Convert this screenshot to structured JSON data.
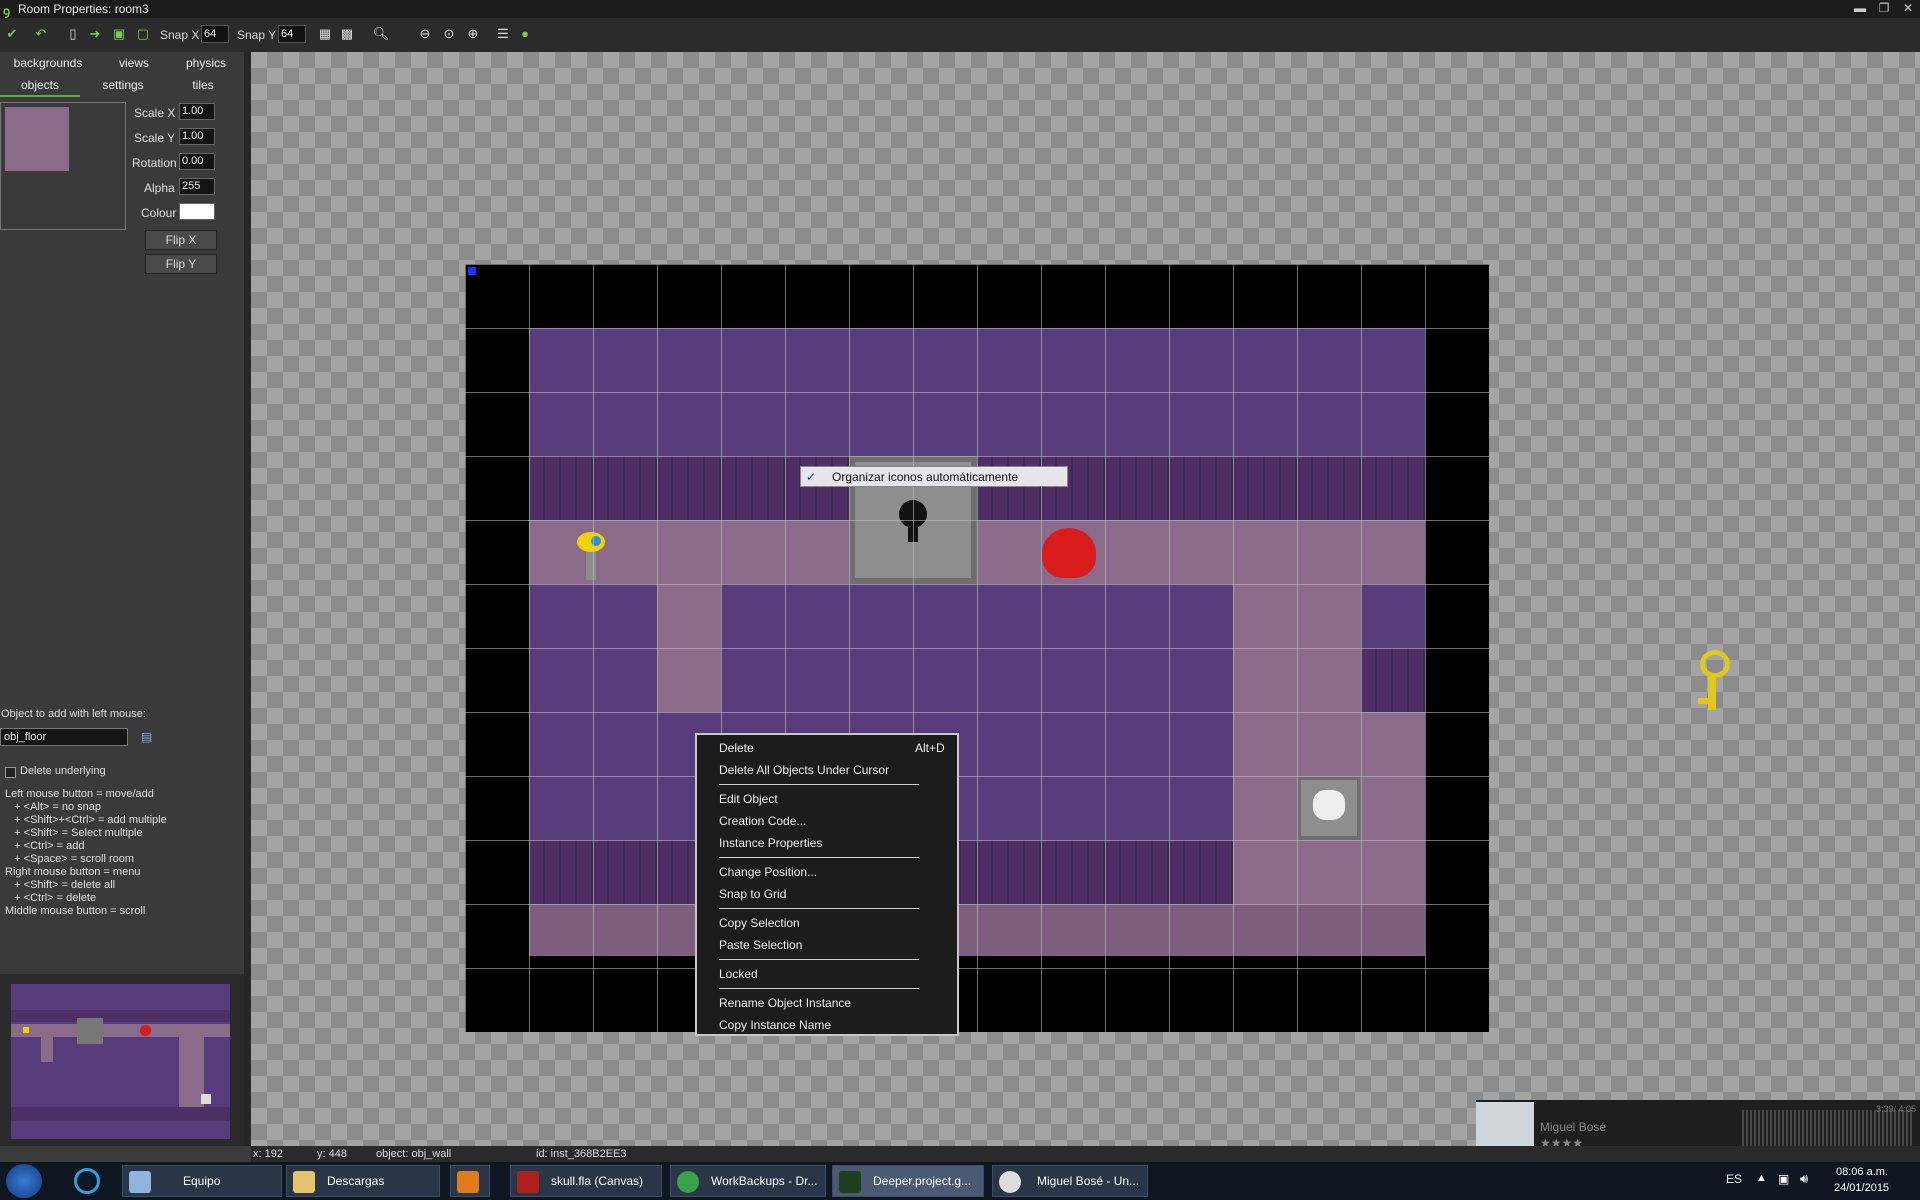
{
  "window": {
    "title": "Room Properties: room3",
    "minimize": "▬",
    "maximize": "❐",
    "close": "✕"
  },
  "toolbar": {
    "snap_x_label": "Snap X",
    "snap_x": "64",
    "snap_y_label": "Snap Y",
    "snap_y": "64"
  },
  "tabs": {
    "row1": [
      "backgrounds",
      "views",
      "physics"
    ],
    "row2": [
      "objects",
      "settings",
      "tiles"
    ]
  },
  "props": {
    "scale_x_label": "Scale X",
    "scale_x": "1.00",
    "scale_y_label": "Scale Y",
    "scale_y": "1.00",
    "rotation_label": "Rotation",
    "rotation": "0.00",
    "alpha_label": "Alpha",
    "alpha": "255",
    "colour_label": "Colour",
    "flip_x": "Flip X",
    "flip_y": "Flip Y"
  },
  "object_panel": {
    "label": "Object to add with left mouse:",
    "value": "obj_floor",
    "delete_underlying": "Delete underlying",
    "help": [
      "Left mouse button = move/add",
      "   + <Alt> = no snap",
      "   + <Shift>+<Ctrl> = add multiple",
      "   + <Shift> = Select multiple",
      "   + <Ctrl> = add",
      "   + <Space> = scroll room",
      "Right mouse button = menu",
      "   + <Shift> = delete all",
      "   + <Ctrl> = delete",
      "Middle mouse button = scroll"
    ]
  },
  "desktop_tooltip": {
    "check": "✓",
    "label": "Organizar iconos automáticamente"
  },
  "context_menu": {
    "items": [
      {
        "label": "Delete",
        "shortcut": "Alt+D"
      },
      {
        "label": "Delete All Objects Under Cursor"
      },
      {
        "label": "Edit Object"
      },
      {
        "label": "Creation Code..."
      },
      {
        "label": "Instance Properties"
      },
      {
        "label": "Change Position..."
      },
      {
        "label": "Snap to Grid"
      },
      {
        "label": "Copy Selection"
      },
      {
        "label": "Paste Selection"
      },
      {
        "label": "Locked"
      },
      {
        "label": "Rename Object Instance"
      },
      {
        "label": "Copy Instance Name"
      }
    ]
  },
  "status": {
    "x": "x: 192",
    "y": "y: 448",
    "object": "object: obj_wall",
    "id": "id: inst_368B2EE3"
  },
  "media": {
    "artist": "Miguel Bosé",
    "rating": "★★★★",
    "time": "3:39/ 4:05"
  },
  "taskbar": {
    "items": [
      "Equipo",
      "Descargas",
      "",
      "skull.fla (Canvas)",
      "WorkBackups - Dr...",
      "Deeper.project.g...",
      "Miguel Bosé - Un..."
    ],
    "lang": "ES",
    "time": "08:06 a.m.",
    "date": "24/01/2015"
  }
}
